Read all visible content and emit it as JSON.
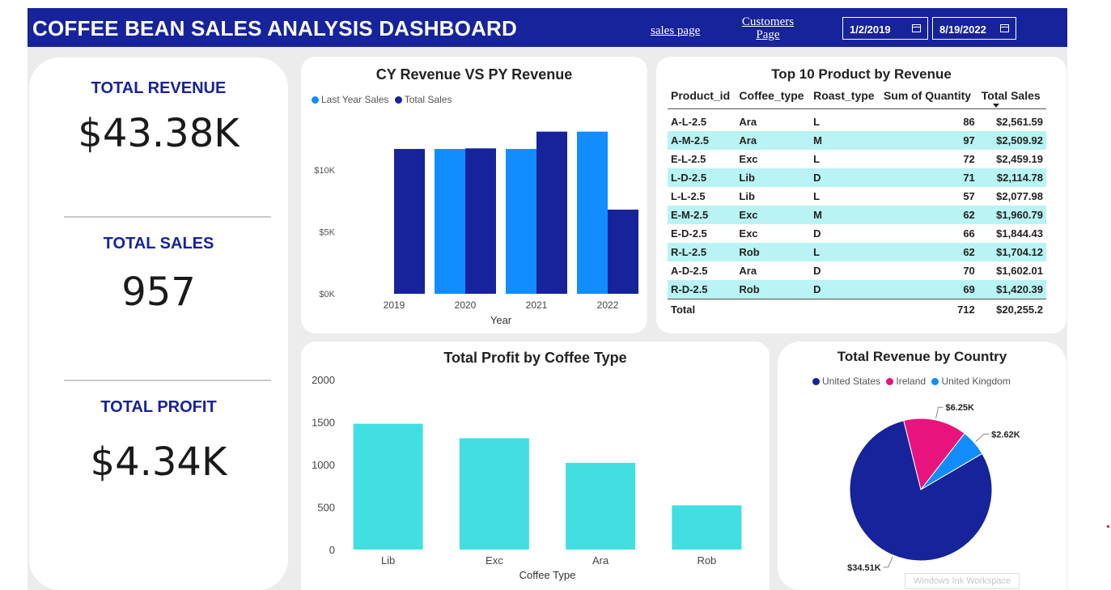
{
  "header": {
    "title": "COFFEE BEAN SALES ANALYSIS DASHBOARD",
    "nav_sales": "sales page",
    "nav_customers_line1": "Customers",
    "nav_customers_line2": "Page",
    "date_start": "1/2/2019",
    "date_end": "8/19/2022"
  },
  "colors": {
    "header_bg": "#16239a",
    "dark_blue": "#16239a",
    "light_blue": "#118dff",
    "cyan": "#41dfe2",
    "pink": "#e8137c",
    "row_highlight": "#b9f3f3"
  },
  "kpis": [
    {
      "label": "TOTAL REVENUE",
      "value": "$43.38K"
    },
    {
      "label": "TOTAL SALES",
      "value": "957"
    },
    {
      "label": "TOTAL PROFIT",
      "value": "$4.34K"
    }
  ],
  "top_products": {
    "title": "Top 10 Product by Revenue",
    "columns": [
      "Product_id",
      "Coffee_type",
      "Roast_type",
      "Sum of Quantity",
      "Total Sales"
    ],
    "rows": [
      [
        "A-L-2.5",
        "Ara",
        "L",
        "86",
        "$2,561.59"
      ],
      [
        "A-M-2.5",
        "Ara",
        "M",
        "97",
        "$2,509.92"
      ],
      [
        "E-L-2.5",
        "Exc",
        "L",
        "72",
        "$2,459.19"
      ],
      [
        "L-D-2.5",
        "Lib",
        "D",
        "71",
        "$2,114.78"
      ],
      [
        "L-L-2.5",
        "Lib",
        "L",
        "57",
        "$2,077.98"
      ],
      [
        "E-M-2.5",
        "Exc",
        "M",
        "62",
        "$1,960.79"
      ],
      [
        "E-D-2.5",
        "Exc",
        "D",
        "66",
        "$1,844.43"
      ],
      [
        "R-L-2.5",
        "Rob",
        "L",
        "62",
        "$1,704.12"
      ],
      [
        "A-D-2.5",
        "Ara",
        "D",
        "70",
        "$1,602.01"
      ],
      [
        "R-D-2.5",
        "Rob",
        "D",
        "69",
        "$1,420.39"
      ]
    ],
    "total_label": "Total",
    "total_quantity": "712",
    "total_sales": "$20,255.2"
  },
  "overlay": {
    "ink_workspace": "Windows Ink Workspace"
  },
  "chart_data": [
    {
      "type": "bar",
      "title": "CY Revenue VS PY Revenue",
      "xlabel": "Year",
      "ylabel": "",
      "categories": [
        "2019",
        "2020",
        "2021",
        "2022"
      ],
      "series": [
        {
          "name": "Last Year Sales",
          "color": "#118dff",
          "values": [
            null,
            11700,
            11700,
            13100
          ]
        },
        {
          "name": "Total Sales",
          "color": "#16239a",
          "values": [
            11700,
            11750,
            13100,
            6800
          ]
        }
      ],
      "yticks": [
        0,
        5000,
        10000
      ],
      "ytick_labels": [
        "$0K",
        "$5K",
        "$10K"
      ],
      "ylim": [
        0,
        13600
      ],
      "legend": "top-left",
      "grid": false
    },
    {
      "type": "bar",
      "title": "Total Profit by Coffee Type",
      "xlabel": "Coffee Type",
      "ylabel": "",
      "categories": [
        "Lib",
        "Exc",
        "Ara",
        "Rob"
      ],
      "values": [
        1480,
        1310,
        1020,
        520
      ],
      "color": "#41dfe2",
      "yticks": [
        0,
        500,
        1000,
        1500,
        2000
      ],
      "ylim": [
        0,
        2000
      ],
      "grid": false
    },
    {
      "type": "pie",
      "title": "Total Revenue by Country",
      "categories": [
        "United States",
        "Ireland",
        "United Kingdom"
      ],
      "values": [
        34.51,
        6.25,
        2.62
      ],
      "labels": [
        "$34.51K",
        "$6.25K",
        "$2.62K"
      ],
      "colors": [
        "#16239a",
        "#e8137c",
        "#118dff"
      ],
      "legend": "top"
    }
  ]
}
